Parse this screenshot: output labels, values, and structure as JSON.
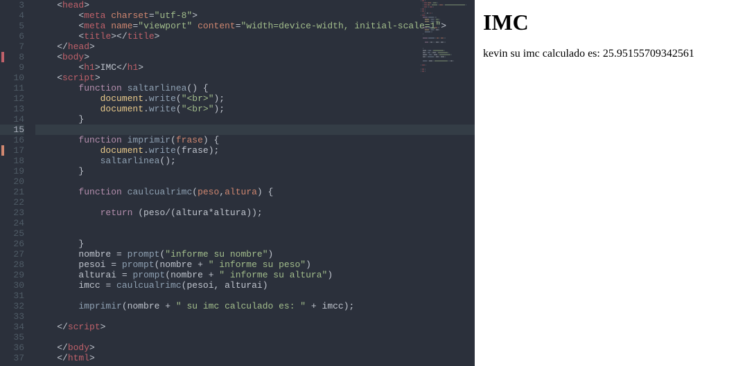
{
  "editor": {
    "firstLineNumber": 3,
    "cursorLine": 15,
    "markers": {
      "8": "red",
      "17": "orange"
    },
    "lines": [
      {
        "n": 3,
        "segs": [
          {
            "i": 1
          },
          {
            "t": "<",
            "c": "punct"
          },
          {
            "t": "head",
            "c": "tag"
          },
          {
            "t": ">",
            "c": "punct"
          }
        ]
      },
      {
        "n": 4,
        "segs": [
          {
            "i": 2
          },
          {
            "t": "<",
            "c": "punct"
          },
          {
            "t": "meta ",
            "c": "tag"
          },
          {
            "t": "charset",
            "c": "attr"
          },
          {
            "t": "=",
            "c": "punct"
          },
          {
            "t": "\"utf-8\"",
            "c": "string"
          },
          {
            "t": ">",
            "c": "punct"
          }
        ]
      },
      {
        "n": 5,
        "segs": [
          {
            "i": 2
          },
          {
            "t": "<",
            "c": "punct"
          },
          {
            "t": "meta ",
            "c": "tag"
          },
          {
            "t": "name",
            "c": "attr"
          },
          {
            "t": "=",
            "c": "punct"
          },
          {
            "t": "\"viewport\"",
            "c": "string"
          },
          {
            "t": " ",
            "c": "punct"
          },
          {
            "t": "content",
            "c": "attr"
          },
          {
            "t": "=",
            "c": "punct"
          },
          {
            "t": "\"width=device-width, initial-scale=1\"",
            "c": "string"
          },
          {
            "t": ">",
            "c": "punct"
          }
        ]
      },
      {
        "n": 6,
        "segs": [
          {
            "i": 2
          },
          {
            "t": "<",
            "c": "punct"
          },
          {
            "t": "title",
            "c": "tag"
          },
          {
            "t": "></",
            "c": "punct"
          },
          {
            "t": "title",
            "c": "tag"
          },
          {
            "t": ">",
            "c": "punct"
          }
        ]
      },
      {
        "n": 7,
        "segs": [
          {
            "i": 1
          },
          {
            "t": "</",
            "c": "punct"
          },
          {
            "t": "head",
            "c": "tag"
          },
          {
            "t": ">",
            "c": "punct"
          }
        ]
      },
      {
        "n": 8,
        "segs": [
          {
            "i": 1
          },
          {
            "t": "<",
            "c": "punct"
          },
          {
            "t": "body",
            "c": "tag"
          },
          {
            "t": ">",
            "c": "punct"
          }
        ]
      },
      {
        "n": 9,
        "segs": [
          {
            "i": 2
          },
          {
            "t": "<",
            "c": "punct"
          },
          {
            "t": "h1",
            "c": "tag"
          },
          {
            "t": ">",
            "c": "punct"
          },
          {
            "t": "IMC",
            "c": "var"
          },
          {
            "t": "</",
            "c": "punct"
          },
          {
            "t": "h1",
            "c": "tag"
          },
          {
            "t": ">",
            "c": "punct"
          }
        ]
      },
      {
        "n": 10,
        "segs": [
          {
            "i": 1
          },
          {
            "t": "<",
            "c": "punct"
          },
          {
            "t": "script",
            "c": "tag"
          },
          {
            "t": ">",
            "c": "punct"
          }
        ]
      },
      {
        "n": 11,
        "segs": [
          {
            "i": 2
          },
          {
            "t": "function ",
            "c": "kw"
          },
          {
            "t": "saltarlinea",
            "c": "fn"
          },
          {
            "t": "() {",
            "c": "punct"
          }
        ]
      },
      {
        "n": 12,
        "segs": [
          {
            "i": 3
          },
          {
            "t": "document",
            "c": "obj"
          },
          {
            "t": ".",
            "c": "punct"
          },
          {
            "t": "write",
            "c": "fn"
          },
          {
            "t": "(",
            "c": "punct"
          },
          {
            "t": "\"<br>\"",
            "c": "string"
          },
          {
            "t": ");",
            "c": "punct"
          }
        ]
      },
      {
        "n": 13,
        "segs": [
          {
            "i": 3
          },
          {
            "t": "document",
            "c": "obj"
          },
          {
            "t": ".",
            "c": "punct"
          },
          {
            "t": "write",
            "c": "fn"
          },
          {
            "t": "(",
            "c": "punct"
          },
          {
            "t": "\"<br>\"",
            "c": "string"
          },
          {
            "t": ");",
            "c": "punct"
          }
        ]
      },
      {
        "n": 14,
        "segs": [
          {
            "i": 2
          },
          {
            "t": "}",
            "c": "punct"
          }
        ]
      },
      {
        "n": 15,
        "segs": []
      },
      {
        "n": 16,
        "segs": [
          {
            "i": 2
          },
          {
            "t": "function ",
            "c": "kw"
          },
          {
            "t": "imprimir",
            "c": "fn"
          },
          {
            "t": "(",
            "c": "punct"
          },
          {
            "t": "frase",
            "c": "param"
          },
          {
            "t": ") {",
            "c": "punct"
          }
        ]
      },
      {
        "n": 17,
        "segs": [
          {
            "i": 3
          },
          {
            "t": "document",
            "c": "obj"
          },
          {
            "t": ".",
            "c": "punct"
          },
          {
            "t": "write",
            "c": "fn"
          },
          {
            "t": "(",
            "c": "punct"
          },
          {
            "t": "frase",
            "c": "var"
          },
          {
            "t": ");",
            "c": "punct"
          }
        ]
      },
      {
        "n": 18,
        "segs": [
          {
            "i": 3
          },
          {
            "t": "saltarlinea",
            "c": "fn"
          },
          {
            "t": "();",
            "c": "punct"
          }
        ]
      },
      {
        "n": 19,
        "segs": [
          {
            "i": 2
          },
          {
            "t": "}",
            "c": "punct"
          }
        ]
      },
      {
        "n": 20,
        "segs": []
      },
      {
        "n": 21,
        "segs": [
          {
            "i": 2
          },
          {
            "t": "function ",
            "c": "kw"
          },
          {
            "t": "caulcualrimc",
            "c": "fn"
          },
          {
            "t": "(",
            "c": "punct"
          },
          {
            "t": "peso",
            "c": "param"
          },
          {
            "t": ",",
            "c": "punct"
          },
          {
            "t": "altura",
            "c": "param"
          },
          {
            "t": ") {",
            "c": "punct"
          }
        ]
      },
      {
        "n": 22,
        "segs": []
      },
      {
        "n": 23,
        "segs": [
          {
            "i": 3
          },
          {
            "t": "return ",
            "c": "kw"
          },
          {
            "t": "(",
            "c": "punct"
          },
          {
            "t": "peso",
            "c": "var"
          },
          {
            "t": "/",
            "c": "op"
          },
          {
            "t": "(",
            "c": "punct"
          },
          {
            "t": "altura",
            "c": "var"
          },
          {
            "t": "*",
            "c": "op"
          },
          {
            "t": "altura",
            "c": "var"
          },
          {
            "t": "));",
            "c": "punct"
          }
        ]
      },
      {
        "n": 24,
        "segs": []
      },
      {
        "n": 25,
        "segs": []
      },
      {
        "n": 26,
        "segs": [
          {
            "i": 2
          },
          {
            "t": "}",
            "c": "punct"
          }
        ]
      },
      {
        "n": 27,
        "segs": [
          {
            "i": 2
          },
          {
            "t": "nombre ",
            "c": "var"
          },
          {
            "t": "= ",
            "c": "op"
          },
          {
            "t": "prompt",
            "c": "fn"
          },
          {
            "t": "(",
            "c": "punct"
          },
          {
            "t": "\"informe su nombre\"",
            "c": "string"
          },
          {
            "t": ")",
            "c": "punct"
          }
        ]
      },
      {
        "n": 28,
        "segs": [
          {
            "i": 2
          },
          {
            "t": "pesoi ",
            "c": "var"
          },
          {
            "t": "= ",
            "c": "op"
          },
          {
            "t": "prompt",
            "c": "fn"
          },
          {
            "t": "(",
            "c": "punct"
          },
          {
            "t": "nombre ",
            "c": "var"
          },
          {
            "t": "+ ",
            "c": "op"
          },
          {
            "t": "\" informe su peso\"",
            "c": "string"
          },
          {
            "t": ")",
            "c": "punct"
          }
        ]
      },
      {
        "n": 29,
        "segs": [
          {
            "i": 2
          },
          {
            "t": "alturai ",
            "c": "var"
          },
          {
            "t": "= ",
            "c": "op"
          },
          {
            "t": "prompt",
            "c": "fn"
          },
          {
            "t": "(",
            "c": "punct"
          },
          {
            "t": "nombre ",
            "c": "var"
          },
          {
            "t": "+ ",
            "c": "op"
          },
          {
            "t": "\" informe su altura\"",
            "c": "string"
          },
          {
            "t": ")",
            "c": "punct"
          }
        ]
      },
      {
        "n": 30,
        "segs": [
          {
            "i": 2
          },
          {
            "t": "imcc ",
            "c": "var"
          },
          {
            "t": "= ",
            "c": "op"
          },
          {
            "t": "caulcualrimc",
            "c": "fn"
          },
          {
            "t": "(",
            "c": "punct"
          },
          {
            "t": "pesoi",
            "c": "var"
          },
          {
            "t": ", ",
            "c": "punct"
          },
          {
            "t": "alturai",
            "c": "var"
          },
          {
            "t": ")",
            "c": "punct"
          }
        ]
      },
      {
        "n": 31,
        "segs": []
      },
      {
        "n": 32,
        "segs": [
          {
            "i": 2
          },
          {
            "t": "imprimir",
            "c": "fn"
          },
          {
            "t": "(",
            "c": "punct"
          },
          {
            "t": "nombre ",
            "c": "var"
          },
          {
            "t": "+ ",
            "c": "op"
          },
          {
            "t": "\" su imc calculado es: \"",
            "c": "string"
          },
          {
            "t": " + ",
            "c": "op"
          },
          {
            "t": "imcc",
            "c": "var"
          },
          {
            "t": ");",
            "c": "punct"
          }
        ]
      },
      {
        "n": 33,
        "segs": []
      },
      {
        "n": 34,
        "segs": [
          {
            "i": 1
          },
          {
            "t": "</",
            "c": "punct"
          },
          {
            "t": "script",
            "c": "tag"
          },
          {
            "t": ">",
            "c": "punct"
          }
        ]
      },
      {
        "n": 35,
        "segs": []
      },
      {
        "n": 36,
        "segs": [
          {
            "i": 1
          },
          {
            "t": "</",
            "c": "punct"
          },
          {
            "t": "body",
            "c": "tag"
          },
          {
            "t": ">",
            "c": "punct"
          }
        ]
      },
      {
        "n": 37,
        "segs": [
          {
            "i": 1
          },
          {
            "t": "</",
            "c": "punct"
          },
          {
            "t": "html",
            "c": "tag"
          },
          {
            "t": ">",
            "c": "punct"
          }
        ]
      }
    ]
  },
  "preview": {
    "heading": "IMC",
    "output": "kevin su imc calculado es: 25.95155709342561"
  }
}
